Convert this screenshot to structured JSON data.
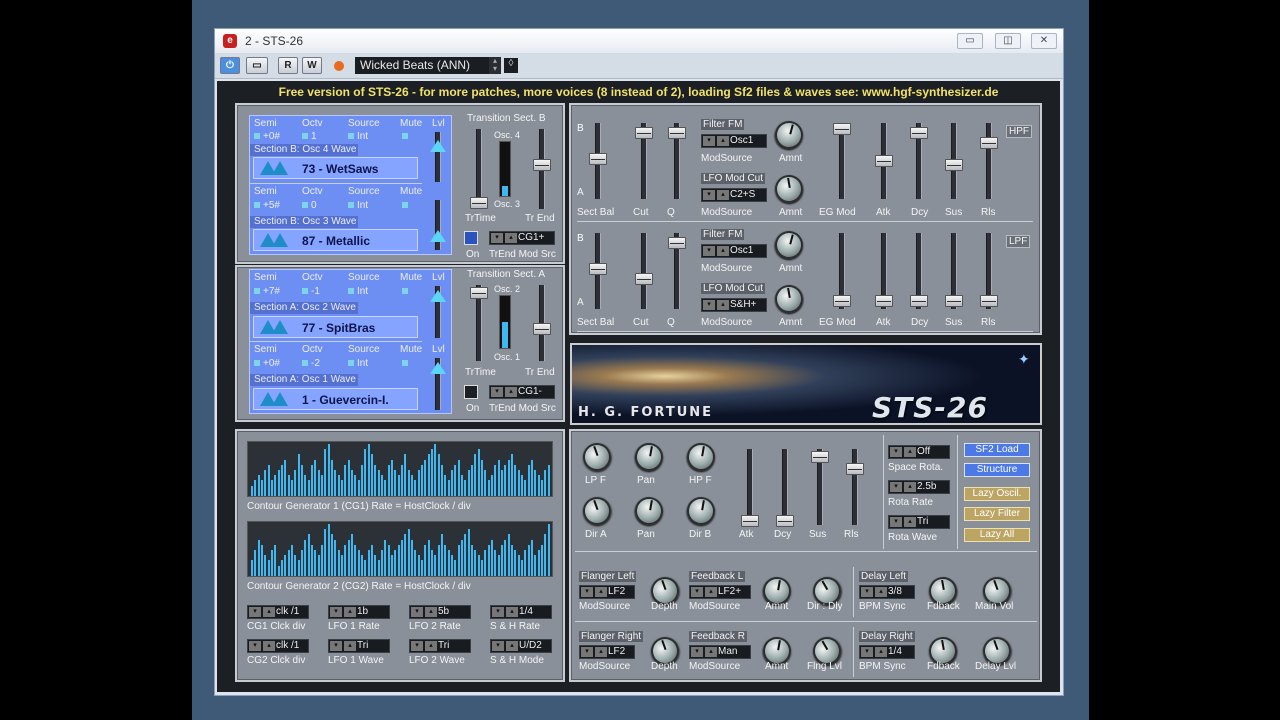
{
  "window": {
    "title": "2 - STS-26",
    "logo": "cubase-logo",
    "controls": [
      "minimize-icon",
      "restore-icon",
      "close-icon"
    ]
  },
  "toolbar": {
    "power": "power-icon",
    "bypass": "compare-icon",
    "read": "R",
    "write": "W",
    "preset": "Wicked Beats (ANN)"
  },
  "banner": "Free version of STS-26 - for more patches, more voices (8 instead of 2), loading Sf2 files & waves see: www.hgf-synthesizer.de",
  "sectionB": {
    "osc4": {
      "headers": [
        "Semi",
        "Octv",
        "Source",
        "Mute",
        "Lvl"
      ],
      "semi": "+0#",
      "octv": "1",
      "source": "Int",
      "wave_label": "Section B: Osc 4 Wave",
      "wave": "73 - WetSaws"
    },
    "osc3": {
      "headers": [
        "Semi",
        "Octv",
        "Source",
        "Mute",
        "Lvl"
      ],
      "semi": "+5#",
      "octv": "0",
      "source": "Int",
      "wave_label": "Section B: Osc 3 Wave",
      "wave": "87 - Metallic"
    },
    "transition": {
      "title": "Transition Sect. B",
      "top": "Osc. 4",
      "bottom": "Osc. 3",
      "trtime": "TrTime",
      "trend": "Tr End",
      "on": "On",
      "modsrc_label": "TrEnd Mod Src",
      "modsrc": "CG1+"
    }
  },
  "sectionA": {
    "osc2": {
      "headers": [
        "Semi",
        "Octv",
        "Source",
        "Mute",
        "Lvl"
      ],
      "semi": "+7#",
      "octv": "-1",
      "source": "Int",
      "wave_label": "Section A: Osc 2 Wave",
      "wave": "77 - SpitBras"
    },
    "osc1": {
      "headers": [
        "Semi",
        "Octv",
        "Source",
        "Mute",
        "Lvl"
      ],
      "semi": "+0#",
      "octv": "-2",
      "source": "Int",
      "wave_label": "Section A: Osc 1 Wave",
      "wave": "1 - Guevercin-I."
    },
    "transition": {
      "title": "Transition Sect. A",
      "top": "Osc. 2",
      "bottom": "Osc. 1",
      "trtime": "TrTime",
      "trend": "Tr End",
      "on": "On",
      "modsrc_label": "TrEnd Mod Src",
      "modsrc": "CG1-"
    }
  },
  "filter1": {
    "b": "B",
    "a": "A",
    "labels": [
      "Sect Bal",
      "Cut",
      "Q",
      "ModSource",
      "Amnt",
      "ModSource",
      "Amnt",
      "EG Mod",
      "Atk",
      "Dcy",
      "Sus",
      "Rls"
    ],
    "fm": "Filter FM",
    "fm_src": "Osc1",
    "lfo": "LFO Mod Cut",
    "lfo_src": "C2+S",
    "type": "HPF"
  },
  "filter2": {
    "b": "B",
    "a": "A",
    "labels": [
      "Sect Bal",
      "Cut",
      "Q",
      "ModSource",
      "Amnt",
      "ModSource",
      "Amnt",
      "EG Mod",
      "Atk",
      "Dcy",
      "Sus",
      "Rls"
    ],
    "fm": "Filter FM",
    "fm_src": "Osc1",
    "lfo": "LFO Mod Cut",
    "lfo_src": "S&H+",
    "type": "LPF"
  },
  "logo": {
    "author": "H. G. FORTUNE",
    "product": "STS-26"
  },
  "contour": {
    "cg1_label": "Contour Generator 1 (CG1)   Rate = HostClock / div",
    "cg2_label": "Contour Generator 2 (CG2)   Rate = HostClock / div",
    "cg1_bars": [
      0.2,
      0.3,
      0.4,
      0.3,
      0.5,
      0.6,
      0.3,
      0.4,
      0.5,
      0.6,
      0.7,
      0.4,
      0.3,
      0.5,
      0.8,
      0.6,
      0.4,
      0.3,
      0.6,
      0.7,
      0.5,
      0.4,
      0.9,
      1.0,
      0.7,
      0.5,
      0.4,
      0.3,
      0.6,
      0.7,
      0.5,
      0.4,
      0.3,
      0.6,
      0.9,
      1.0,
      0.8,
      0.6,
      0.5,
      0.4,
      0.3,
      0.6,
      0.7,
      0.5,
      0.4,
      0.6,
      0.8,
      0.5,
      0.4,
      0.3,
      0.5,
      0.6,
      0.7,
      0.8,
      0.9,
      1.0,
      0.8,
      0.6,
      0.4,
      0.3,
      0.5,
      0.6,
      0.7,
      0.4,
      0.3,
      0.5,
      0.6,
      0.8,
      0.9,
      0.7,
      0.5,
      0.3,
      0.4,
      0.6,
      0.7,
      0.5,
      0.6,
      0.7,
      0.8,
      0.6,
      0.5,
      0.4,
      0.3,
      0.6,
      0.7,
      0.5,
      0.4,
      0.3,
      0.5,
      0.6
    ],
    "cg2_bars": [
      0.3,
      0.5,
      0.7,
      0.6,
      0.4,
      0.3,
      0.5,
      0.6,
      0.2,
      0.3,
      0.4,
      0.5,
      0.6,
      0.4,
      0.3,
      0.5,
      0.7,
      0.8,
      0.6,
      0.5,
      0.4,
      0.6,
      0.9,
      1.0,
      0.8,
      0.7,
      0.5,
      0.4,
      0.6,
      0.7,
      0.8,
      0.6,
      0.5,
      0.4,
      0.3,
      0.5,
      0.6,
      0.4,
      0.3,
      0.5,
      0.7,
      0.6,
      0.4,
      0.5,
      0.6,
      0.7,
      0.8,
      0.9,
      0.7,
      0.5,
      0.4,
      0.3,
      0.6,
      0.7,
      0.5,
      0.4,
      0.6,
      0.8,
      0.6,
      0.5,
      0.4,
      0.3,
      0.6,
      0.7,
      0.8,
      0.9,
      0.6,
      0.5,
      0.4,
      0.3,
      0.5,
      0.6,
      0.7,
      0.5,
      0.4,
      0.6,
      0.7,
      0.8,
      0.6,
      0.5,
      0.4,
      0.3,
      0.5,
      0.6,
      0.7,
      0.4,
      0.5,
      0.6,
      0.8,
      1.0
    ],
    "row1": [
      {
        "val": "clk /1",
        "lbl": "CG1 Clck div"
      },
      {
        "val": "1b",
        "lbl": "LFO 1 Rate"
      },
      {
        "val": "5b",
        "lbl": "LFO 2 Rate"
      },
      {
        "val": "1/4",
        "lbl": "S & H Rate"
      }
    ],
    "row2": [
      {
        "val": "clk /1",
        "lbl": "CG2 Clck div"
      },
      {
        "val": "Tri",
        "lbl": "LFO 1 Wave"
      },
      {
        "val": "Tri",
        "lbl": "LFO 2 Wave"
      },
      {
        "val": "U/D2",
        "lbl": "S & H Mode"
      }
    ]
  },
  "amp": {
    "knobs": [
      "LP F",
      "Pan",
      "HP F",
      "Dir A",
      "Pan",
      "Dir B"
    ],
    "env": [
      "Atk",
      "Dcy",
      "Sus",
      "Rls"
    ]
  },
  "space": {
    "rota": "Off",
    "rota_label": "Space Rota.",
    "rate": "2.5b",
    "rate_label": "Rota Rate",
    "wave": "Tri",
    "wave_label": "Rota Wave"
  },
  "buttons": {
    "sf2": "SF2 Load",
    "structure": "Structure",
    "lazy_osc": "Lazy Oscil.",
    "lazy_filter": "Lazy Filter",
    "lazy_all": "Lazy All"
  },
  "fx": {
    "flanger_left": "Flanger Left",
    "flanger_left_src": "LF2",
    "flanger_right": "Flanger Right",
    "flanger_right_src": "LF2",
    "feedback_l": "Feedback L",
    "feedback_l_src": "LF2+",
    "feedback_r": "Feedback R",
    "feedback_r_src": "Man",
    "modsource": "ModSource",
    "depth": "Depth",
    "amnt": "Amnt",
    "dir_dly": "Dir : Dly",
    "flng_lvl": "Flng Lvl",
    "delay_left": "Delay Left",
    "delay_left_val": "3/8",
    "delay_right": "Delay Right",
    "delay_right_val": "1/4",
    "bpm_sync": "BPM Sync",
    "fdback": "Fdback",
    "main_vol": "Main Vol",
    "delay_lvl": "Delay Lvl"
  }
}
